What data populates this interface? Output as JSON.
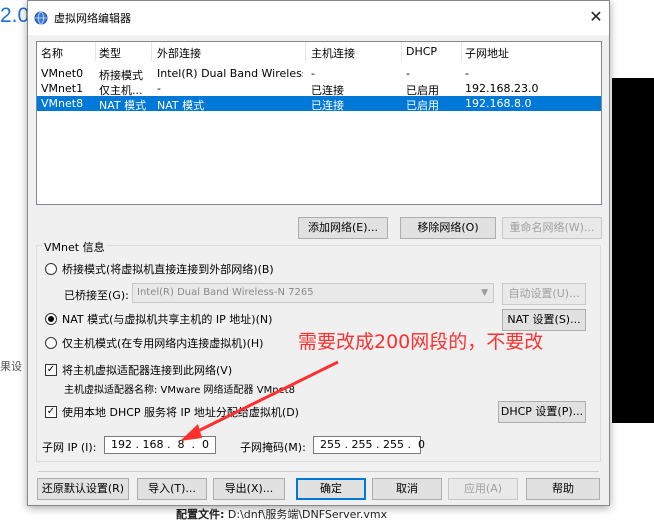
{
  "background": {
    "version_text": "2.0",
    "side_text": "果设",
    "config_label": "配置文件:",
    "config_path": "D:\\dnf\\服务端\\DNFServer.vmx"
  },
  "dialog": {
    "title": "虚拟网络编辑器",
    "close": "✕"
  },
  "network_table": {
    "columns": [
      "名称",
      "类型",
      "外部连接",
      "主机连接",
      "DHCP",
      "子网地址"
    ],
    "rows": [
      [
        "VMnet0",
        "桥接模式",
        "Intel(R) Dual Band Wireless-...",
        "-",
        "-",
        "-"
      ],
      [
        "VMnet1",
        "仅主机...",
        "-",
        "已连接",
        "已启用",
        "192.168.23.0"
      ],
      [
        "VMnet8",
        "NAT 模式",
        "NAT 模式",
        "已连接",
        "已启用",
        "192.168.8.0"
      ]
    ],
    "selected_row": 2
  },
  "table_buttons": {
    "add": "添加网络(E)...",
    "remove": "移除网络(O)",
    "rename": "重命名网络(W)..."
  },
  "vmnet_info": {
    "group_label": "VMnet 信息",
    "bridged_label": "桥接模式(将虚拟机直接连接到外部网络)(B)",
    "bridged_to_label": "已桥接至(G):",
    "bridged_to_value": "Intel(R) Dual Band Wireless-N 7265",
    "auto_settings": "自动设置(U)...",
    "nat_label": "NAT 模式(与虚拟机共享主机的 IP 地址)(N)",
    "nat_settings": "NAT 设置(S)...",
    "hostonly_label": "仅主机模式(在专用网络内连接虚拟机)(H)",
    "connect_adapter_label": "将主机虚拟适配器连接到此网络(V)",
    "adapter_name_label": "主机虚拟适配器名称: VMware 网络适配器 VMnet8",
    "dhcp_label": "使用本地 DHCP 服务将 IP 地址分配给虚拟机(D)",
    "dhcp_settings": "DHCP 设置(P)...",
    "subnet_ip_label": "子网 IP (I):",
    "subnet_ip_value": "192 . 168 .  8  .  0",
    "subnet_mask_label": "子网掩码(M):",
    "subnet_mask_value": "255 . 255 . 255 .  0",
    "selected_mode": "nat",
    "connect_adapter_checked": true,
    "dhcp_checked": true
  },
  "annotation": {
    "text": "需要改成200网段的，不要改",
    "color": "#ff3030"
  },
  "footer_buttons": {
    "restore": "还原默认设置(R)",
    "import": "导入(T)...",
    "export": "导出(X)...",
    "ok": "确定",
    "cancel": "取消",
    "apply": "应用(A)",
    "help": "帮助"
  },
  "colors": {
    "selection": "#0078d7",
    "dialog_bg": "#f0f0f0"
  }
}
